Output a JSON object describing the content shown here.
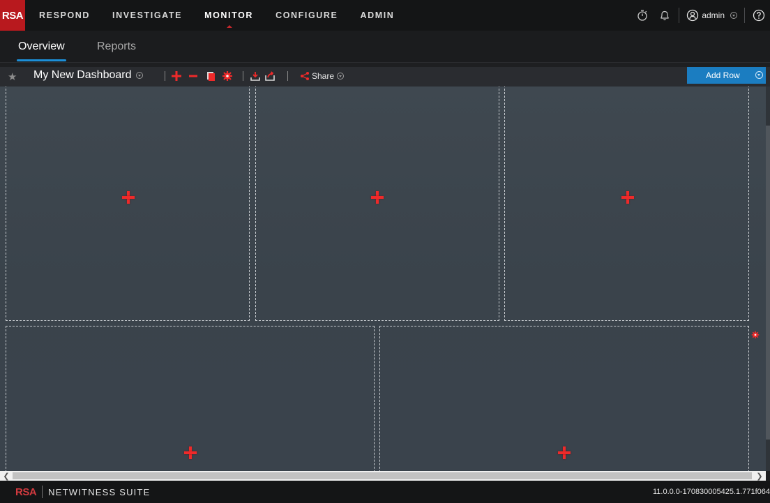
{
  "topnav": {
    "logo": "RSA",
    "items": [
      "RESPOND",
      "INVESTIGATE",
      "MONITOR",
      "CONFIGURE",
      "ADMIN"
    ],
    "active": "MONITOR",
    "user": "admin"
  },
  "subnav": {
    "tabs": [
      "Overview",
      "Reports"
    ],
    "active": "Overview"
  },
  "toolbar": {
    "dashboard_title": "My New Dashboard",
    "share_label": "Share",
    "add_row_label": "Add Row"
  },
  "footer": {
    "logo": "RSA",
    "suite": "NETWITNESS SUITE",
    "version": "11.0.0.0-170830005425.1.771f064"
  },
  "colors": {
    "accent_blue": "#1b7dc1",
    "brand_red": "#b8191e",
    "add_widget_red": "#ee2a2a"
  }
}
